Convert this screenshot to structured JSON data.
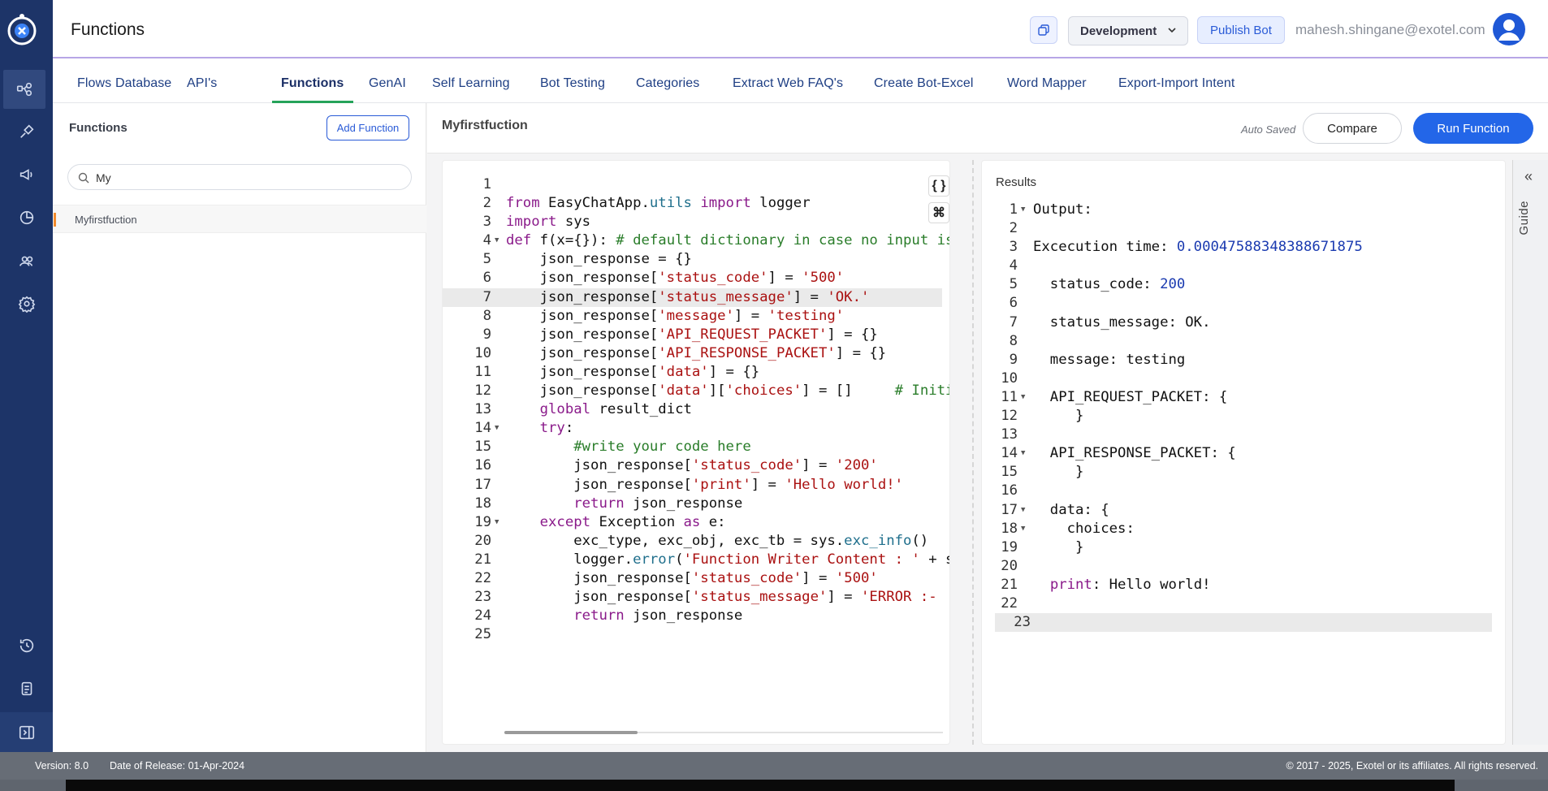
{
  "app": {
    "title": "Functions"
  },
  "topbar": {
    "environment": "Development",
    "publish_label": "Publish Bot",
    "user_email": "mahesh.shingane@exotel.com"
  },
  "tabs": [
    "Flows",
    "Database",
    "API's",
    "Functions",
    "GenAI",
    "Self Learning",
    "Bot Testing",
    "Categories",
    "Extract Web FAQ's",
    "Create Bot-Excel",
    "Word Mapper",
    "Export-Import Intent"
  ],
  "active_tab": "Functions",
  "sidebar": {
    "title": "Functions",
    "add_label": "Add Function",
    "search_value": "My",
    "items": [
      "Myfirstfuction"
    ]
  },
  "editor": {
    "function_name": "Myfirstfuction",
    "autosaved": "Auto Saved",
    "compare_label": "Compare",
    "run_label": "Run Function",
    "highlighted_line": 7,
    "code_lines": [
      "",
      "from EasyChatApp.utils import logger",
      "import sys",
      "def f(x={}): # default dictionary in case no input is pa",
      "    json_response = {}",
      "    json_response['status_code'] = '500'",
      "    json_response['status_message'] = 'OK.'",
      "    json_response['message'] = 'testing'",
      "    json_response['API_REQUEST_PACKET'] = {}",
      "    json_response['API_RESPONSE_PACKET'] = {}",
      "    json_response['data'] = {}",
      "    json_response['data']['choices'] = []     # Initiali",
      "    global result_dict",
      "    try:",
      "        #write your code here",
      "        json_response['status_code'] = '200'",
      "        json_response['print'] = 'Hello world!'",
      "        return json_response",
      "    except Exception as e:",
      "        exc_type, exc_obj, exc_tb = sys.exc_info()",
      "        logger.error('Function Writer Content : ' + str(",
      "        json_response['status_code'] = '500'",
      "        json_response['status_message'] = 'ERROR :-  '+s",
      "        return json_response",
      ""
    ],
    "fold_lines": [
      4,
      14,
      19
    ]
  },
  "results": {
    "title": "Results",
    "highlighted_line": 23,
    "fold_lines": [
      1,
      11,
      14,
      17,
      18
    ],
    "lines": [
      "Output:",
      "",
      "Excecution time: 0.00047588348388671875",
      "",
      "  status_code: 200",
      "",
      "  status_message: OK.",
      "",
      "  message: testing",
      "",
      "  API_REQUEST_PACKET: {",
      "     }",
      "",
      "  API_RESPONSE_PACKET: {",
      "     }",
      "",
      "  data: {",
      "    choices:",
      "     }",
      "",
      "  print: Hello world!",
      "",
      ""
    ]
  },
  "guide_label": "Guide",
  "footer": {
    "version": "Version: 8.0",
    "release": "Date of Release: 01-Apr-2024",
    "copyright": "© 2017 - 2025, Exotel or its affiliates. All rights reserved."
  },
  "colors": {
    "rail": "#1d3468",
    "accent": "#2366e8",
    "active_tab_underline": "#25a35a"
  }
}
